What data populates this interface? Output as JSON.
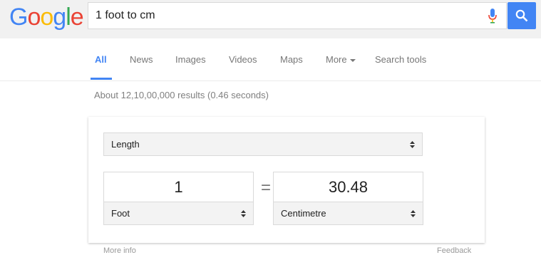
{
  "logo": {
    "letters": [
      "G",
      "o",
      "o",
      "g",
      "l",
      "e"
    ],
    "colors": [
      "#4285f4",
      "#ea4335",
      "#fbbc05",
      "#4285f4",
      "#34a853",
      "#ea4335"
    ]
  },
  "search": {
    "query": "1 foot to cm"
  },
  "tabs": [
    {
      "label": "All",
      "active": true
    },
    {
      "label": "News"
    },
    {
      "label": "Images"
    },
    {
      "label": "Videos"
    },
    {
      "label": "Maps"
    },
    {
      "label": "More"
    },
    {
      "label": "Search tools"
    }
  ],
  "results": {
    "stats": "About 12,10,00,000 results (0.46 seconds)"
  },
  "converter": {
    "category": "Length",
    "from_value": "1",
    "from_unit": "Foot",
    "equals": "=",
    "to_value": "30.48",
    "to_unit": "Centimetre"
  },
  "footer": {
    "more_info": "More info",
    "feedback": "Feedback"
  },
  "colors": {
    "accent": "#4285f4",
    "header_bg": "#f1f1f1"
  }
}
